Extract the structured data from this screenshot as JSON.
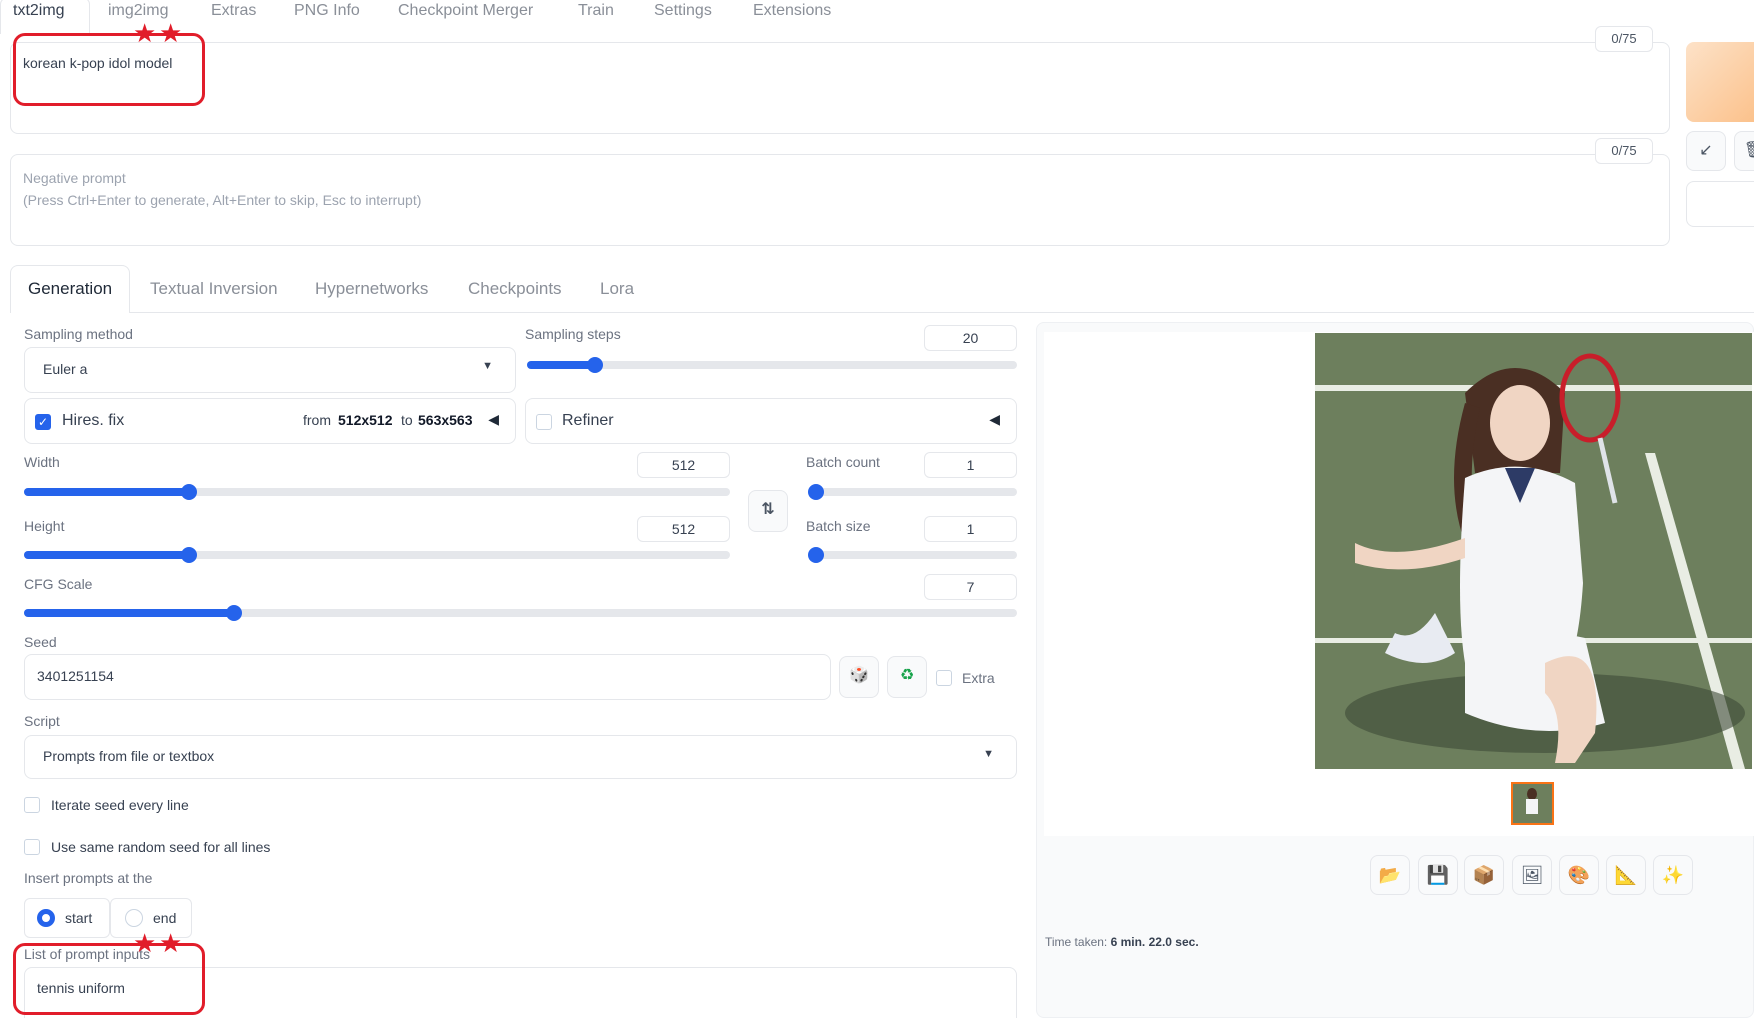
{
  "top_tabs": [
    "txt2img",
    "img2img",
    "Extras",
    "PNG Info",
    "Checkpoint Merger",
    "Train",
    "Settings",
    "Extensions"
  ],
  "prompt": {
    "value": "korean k-pop idol model",
    "token_count": "0/75"
  },
  "negative_prompt": {
    "placeholder_line1": "Negative prompt",
    "placeholder_line2": "(Press Ctrl+Enter to generate, Alt+Enter to skip, Esc to interrupt)",
    "token_count": "0/75"
  },
  "mid_tabs": [
    "Generation",
    "Textual Inversion",
    "Hypernetworks",
    "Checkpoints",
    "Lora"
  ],
  "sampling": {
    "method_label": "Sampling method",
    "method_value": "Euler a",
    "steps_label": "Sampling steps",
    "steps_value": "20"
  },
  "hires": {
    "label": "Hires. fix",
    "from_text": "from",
    "from_size": "512x512",
    "to_text": "to",
    "to_size": "563x563",
    "checked": true
  },
  "refiner": {
    "label": "Refiner",
    "checked": false
  },
  "width": {
    "label": "Width",
    "value": "512"
  },
  "height": {
    "label": "Height",
    "value": "512"
  },
  "batch_count": {
    "label": "Batch count",
    "value": "1"
  },
  "batch_size": {
    "label": "Batch size",
    "value": "1"
  },
  "cfg": {
    "label": "CFG Scale",
    "value": "7"
  },
  "seed": {
    "label": "Seed",
    "value": "3401251154",
    "extra_label": "Extra"
  },
  "script": {
    "label": "Script",
    "value": "Prompts from file or textbox"
  },
  "iterate_seed": {
    "label": "Iterate seed every line",
    "checked": false
  },
  "same_seed": {
    "label": "Use same random seed for all lines",
    "checked": false
  },
  "insert_prompts": {
    "label": "Insert prompts at the",
    "options": [
      "start",
      "end"
    ],
    "selected": "start"
  },
  "prompt_list": {
    "label": "List of prompt inputs",
    "value": "tennis uniform"
  },
  "output": {
    "time_label": "Time taken:",
    "time_value": "6 min. 22.0 sec.",
    "toolbar_icons": [
      "folder-icon",
      "save-icon",
      "zip-icon",
      "send-to-img2img-icon",
      "send-to-inpaint-icon",
      "send-to-extras-icon",
      "sparkle-icon"
    ]
  },
  "colors": {
    "accent": "#2563eb",
    "callout": "#e11d2a",
    "generate_button": "#fbbf87"
  }
}
